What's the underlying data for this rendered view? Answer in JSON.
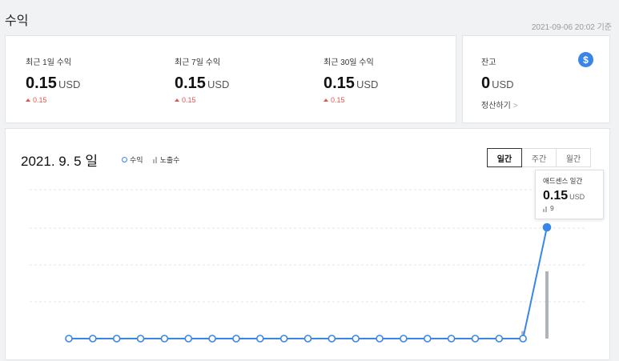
{
  "header": {
    "title": "수익",
    "timestamp": "2021-09-06 20:02 기준"
  },
  "stats": [
    {
      "label": "최근 1일 수익",
      "value": "0.15",
      "unit": "USD",
      "change": "0.15"
    },
    {
      "label": "최근 7일 수익",
      "value": "0.15",
      "unit": "USD",
      "change": "0.15"
    },
    {
      "label": "최근 30일 수익",
      "value": "0.15",
      "unit": "USD",
      "change": "0.15"
    }
  ],
  "balance": {
    "label": "잔고",
    "value": "0",
    "unit": "USD",
    "settle_label": "정산하기",
    "chevron": ">",
    "icon_symbol": "$"
  },
  "chart": {
    "date": "2021. 9. 5 일",
    "legend": {
      "revenue": "수익",
      "impressions": "노출수"
    },
    "tabs": [
      {
        "label": "일간",
        "active": true
      },
      {
        "label": "주간",
        "active": false
      },
      {
        "label": "월간",
        "active": false
      }
    ],
    "tooltip": {
      "title": "애드센스 일간",
      "value": "0.15",
      "unit": "USD",
      "impressions": "9"
    }
  },
  "chart_data": {
    "type": "line",
    "series": [
      {
        "name": "수익",
        "values": [
          0,
          0,
          0,
          0,
          0,
          0,
          0,
          0,
          0,
          0,
          0,
          0,
          0,
          0,
          0,
          0,
          0,
          0,
          0,
          0,
          0.15
        ]
      },
      {
        "name": "노출수",
        "values": [
          0,
          0,
          0,
          0,
          0,
          0,
          0,
          0,
          0,
          0,
          0,
          0,
          0,
          0,
          0,
          0,
          0,
          0,
          0,
          1,
          9
        ]
      }
    ],
    "max_value": 0.15,
    "grid": true,
    "colors": {
      "line": "#3a86e8",
      "bar": "#aeb4bc",
      "grid": "#e3e5e8"
    }
  }
}
